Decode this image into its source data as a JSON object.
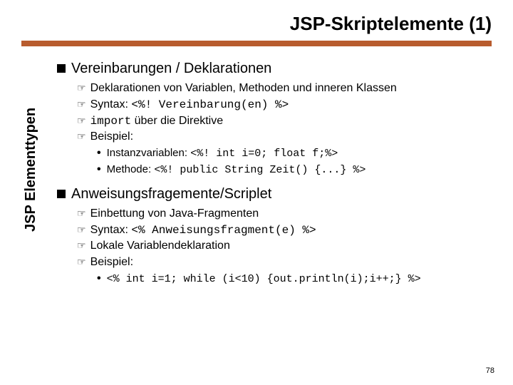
{
  "title": "JSP-Skriptelemente (1)",
  "sidebar_label": "JSP Elementtypen",
  "sections": [
    {
      "heading": "Vereinbarungen / Deklarationen",
      "items": [
        {
          "text": "Deklarationen von Variablen, Methoden und inneren Klassen"
        },
        {
          "prefix": "Syntax: ",
          "code": "<%! Vereinbarung(en) %>"
        },
        {
          "code_first": "import",
          "suffix": " über die Direktive"
        },
        {
          "text": "Beispiel:"
        }
      ],
      "sub": [
        {
          "prefix": "Instanzvariablen: ",
          "code": "<%! int i=0; float f;%>"
        },
        {
          "prefix": "Methode: ",
          "code": "<%! public String Zeit() {...} %>"
        }
      ]
    },
    {
      "heading": "Anweisungsfragemente/Scriplet",
      "items": [
        {
          "text": "Einbettung von Java-Fragmenten"
        },
        {
          "prefix": "Syntax: ",
          "code": "<% Anweisungsfragment(e) %>"
        },
        {
          "text": "Lokale Variablendeklaration"
        },
        {
          "text": "Beispiel:"
        }
      ],
      "sub": [
        {
          "code": "<% int i=1; while (i<10) {out.println(i);i++;} %>"
        }
      ]
    }
  ],
  "page_number": "78"
}
